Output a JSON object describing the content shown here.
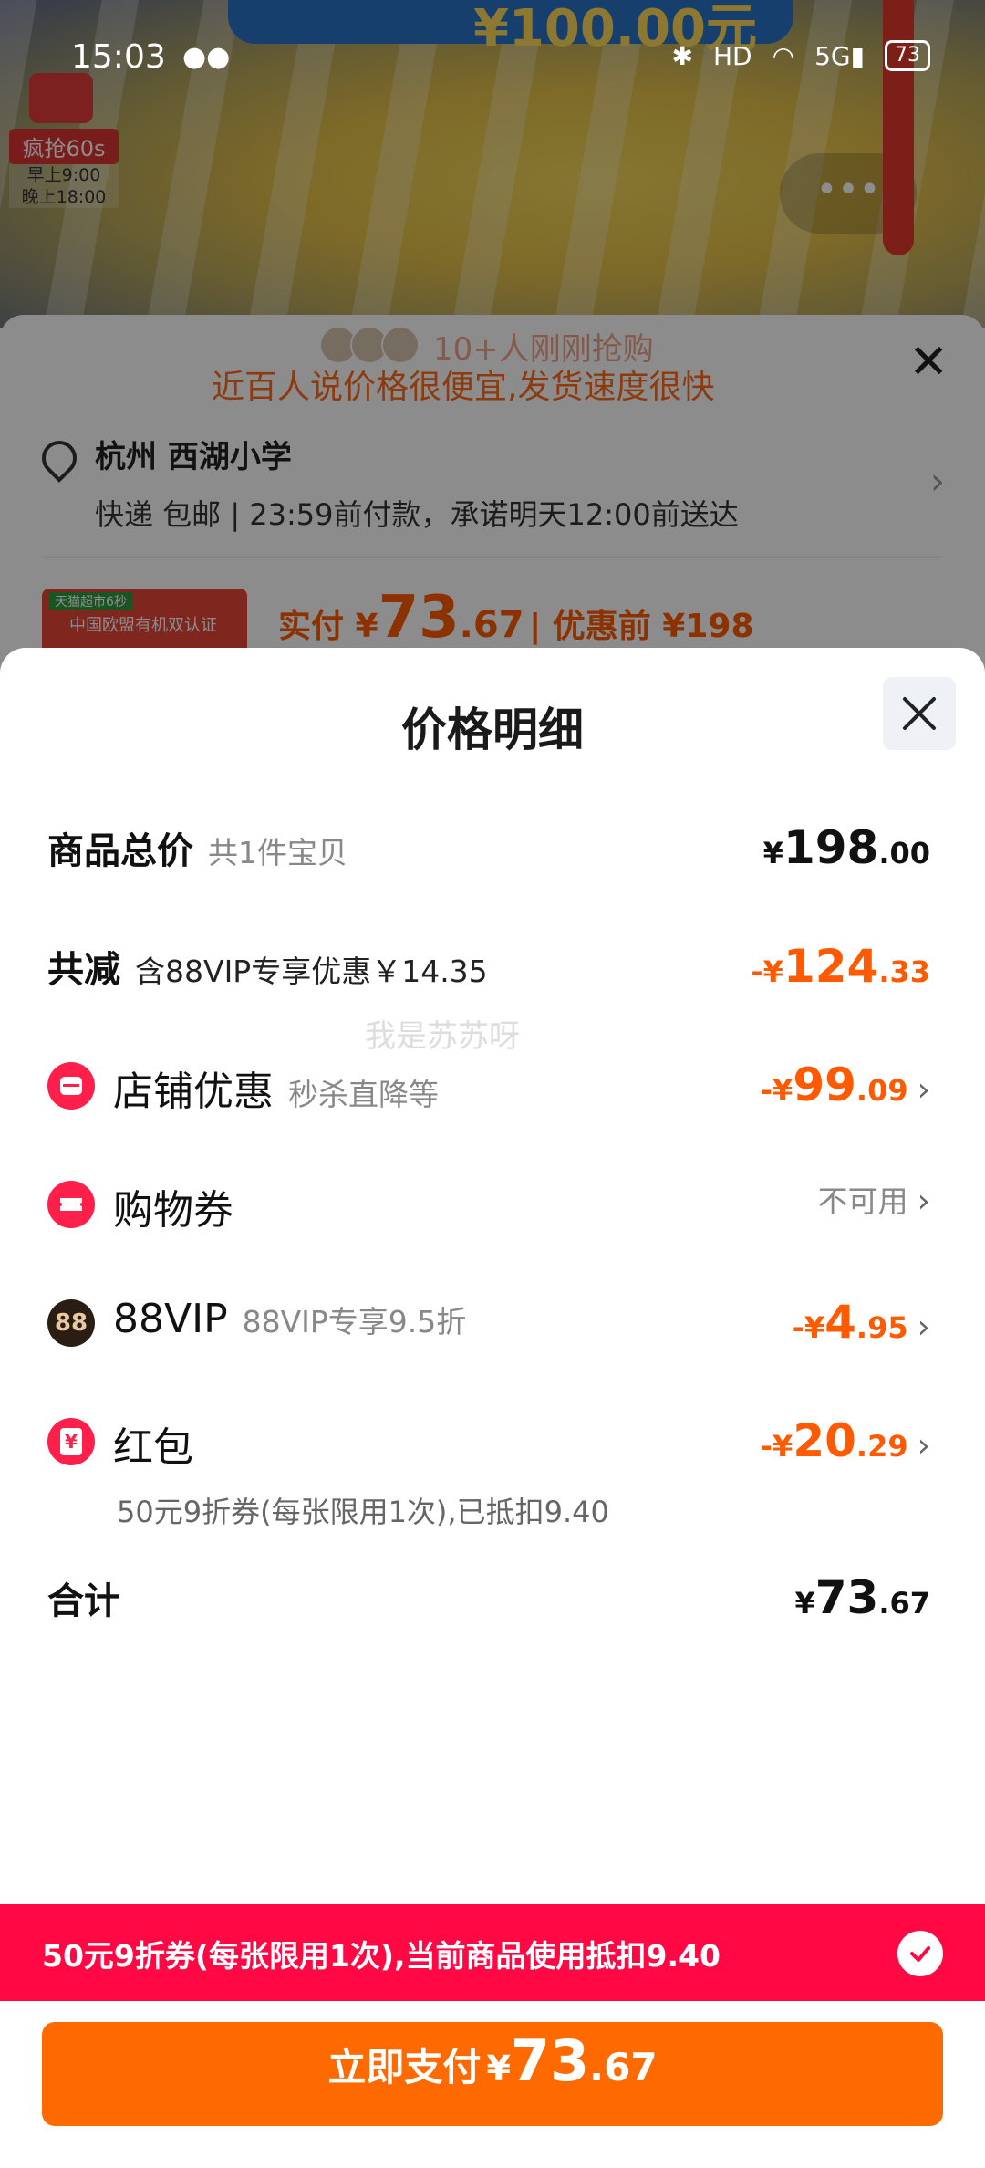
{
  "status_bar": {
    "time": "15:03",
    "hd": "HD",
    "network": "5G",
    "battery": "73"
  },
  "background": {
    "flash_badge": "疯抢60s",
    "flash_time_morning": "早上9:00",
    "flash_time_evening": "晚上18:00",
    "banner_price": "¥100.00元",
    "more_button": "•••"
  },
  "order_sheet": {
    "recent_buyers": "10+人刚刚抢购",
    "praise": "近百人说价格很便宜,发货速度很快",
    "address": "杭州 西湖小学",
    "delivery": "快递 包邮 | 23:59前付款，承诺明天12:00前送达",
    "product_tag": "天猫超市6秒",
    "product_text": "中国欧盟有机双认证",
    "pay_prefix": "实付 ¥",
    "pay_int": "73",
    "pay_dec": ".67",
    "before_discount": "| 优惠前 ¥198"
  },
  "modal": {
    "title": "价格明细",
    "total": {
      "label": "商品总价",
      "sub": "共1件宝贝",
      "cur": "¥",
      "int": "198",
      "dec": ".00"
    },
    "reduce": {
      "label": "共减",
      "note": "含88VIP专享优惠￥14.35",
      "cur": "-¥",
      "int": "124",
      "dec": ".33"
    },
    "shop": {
      "label": "店铺优惠",
      "sub": "秒杀直降等",
      "cur": "-¥",
      "int": "99",
      "dec": ".09"
    },
    "voucher": {
      "label": "购物券",
      "status": "不可用"
    },
    "vip": {
      "icon_text": "88",
      "label": "88VIP",
      "sub": "88VIP专享9.5折",
      "cur": "-¥",
      "int": "4",
      "dec": ".95"
    },
    "redpack": {
      "icon_text": "¥",
      "label": "红包",
      "desc": "50元9折券(每张限用1次),已抵扣9.40",
      "cur": "-¥",
      "int": "20",
      "dec": ".29"
    },
    "sum": {
      "label": "合计",
      "cur": "¥",
      "int": "73",
      "dec": ".67"
    }
  },
  "watermark": "我是苏苏呀",
  "coupon_bar": {
    "text": "50元9折券(每张限用1次),当前商品使用抵扣9.40"
  },
  "pay_button": {
    "label": "立即支付",
    "cur": "¥",
    "int": "73",
    "dec": ".67"
  },
  "colors": {
    "accent_orange": "#ff5a00",
    "pay_button": "#ff6a00",
    "coupon_bar": "#ff0844",
    "shop_icon": "#ff1f4b"
  }
}
